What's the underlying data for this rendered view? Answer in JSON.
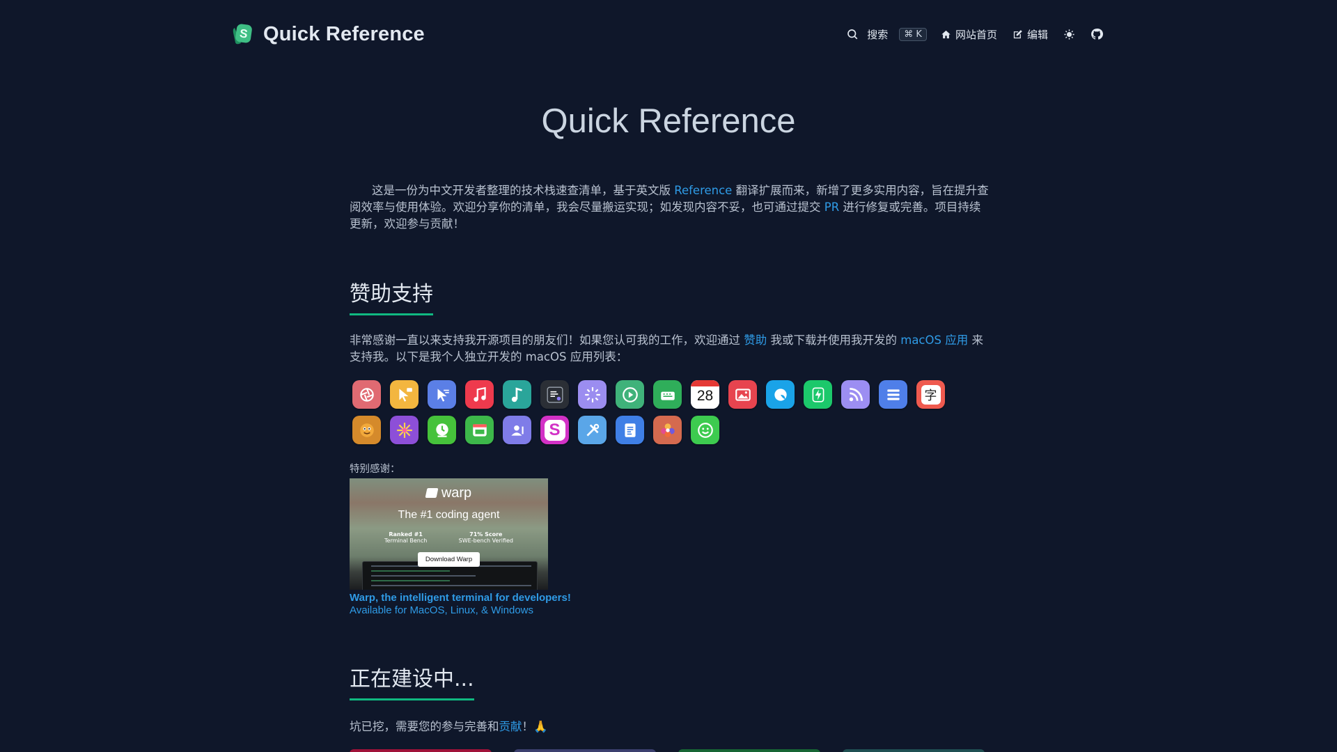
{
  "header": {
    "brand_title": "Quick Reference",
    "search_label": "搜索",
    "search_shortcut": "⌘ K",
    "home_label": "网站首页",
    "edit_label": "编辑"
  },
  "hero": {
    "title": "Quick Reference",
    "intro_1": "这是一份为中文开发者整理的技术栈速查清单，基于英文版 ",
    "intro_link_reference": "Reference",
    "intro_2": " 翻译扩展而来，新增了更多实用内容，旨在提升查阅效率与使用体验。欢迎分享你的清单，我会尽量搬运实现；如发现内容不妥，也可通过提交 ",
    "intro_link_pr": "PR",
    "intro_3": " 进行修复或完善。项目持续更新，欢迎参与贡献！"
  },
  "sponsor": {
    "heading": "赞助支持",
    "text_1": "非常感谢一直以来支持我开源项目的朋友们！如果您认可我的工作，欢迎通过 ",
    "link_sponsor": "赞助",
    "text_2": " 我或下载并使用我开发的 ",
    "link_macos": "macOS 应用",
    "text_3": " 来支持我。以下是我个人独立开发的 macOS 应用列表：",
    "apps": [
      {
        "icon": "aperture-icon",
        "bg": "#e06a72"
      },
      {
        "icon": "cursor-note-icon",
        "bg": "#f3b63f"
      },
      {
        "icon": "pointer-icon",
        "bg": "#5b7fe6"
      },
      {
        "icon": "music-note-icon",
        "bg": "#ee3a4d"
      },
      {
        "icon": "music-teal-icon",
        "bg": "#2aa59a"
      },
      {
        "icon": "terminal-icon",
        "bg": "#2b2f36"
      },
      {
        "icon": "sparkle-cursor-icon",
        "bg": "#9b8df0"
      },
      {
        "icon": "play-icon",
        "bg": "#3fb27a"
      },
      {
        "icon": "keyboard-icon",
        "bg": "#2fae5a"
      },
      {
        "icon": "calendar-icon",
        "bg": "#f4f4f4"
      },
      {
        "icon": "photo-icon",
        "bg": "#e7444f"
      },
      {
        "icon": "bubble-icon",
        "bg": "#1aa3e8"
      },
      {
        "icon": "bolt-icon",
        "bg": "#1cc86b"
      },
      {
        "icon": "rss-icon",
        "bg": "#9c8ef2"
      },
      {
        "icon": "list-icon",
        "bg": "#4f7fe9"
      },
      {
        "icon": "character-icon",
        "bg": "#ef5a4f"
      },
      {
        "icon": "mascot-icon",
        "bg": "#d58a2b"
      },
      {
        "icon": "color-burst-icon",
        "bg": "#8d4fd8"
      },
      {
        "icon": "clock-icon",
        "bg": "#46c23b"
      },
      {
        "icon": "window-icon",
        "bg": "#3db84a"
      },
      {
        "icon": "contacts-icon",
        "bg": "#7f7ce8"
      },
      {
        "icon": "letter-s-icon",
        "bg": "#d231c6"
      },
      {
        "icon": "tools-icon",
        "bg": "#5aa6e8"
      },
      {
        "icon": "document-icon",
        "bg": "#3f7fe6"
      },
      {
        "icon": "flower-icon",
        "bg": "#d56a4f"
      },
      {
        "icon": "smile-icon",
        "bg": "#3dcb4f"
      }
    ],
    "calendar_day": "28",
    "letter_s": "S",
    "character_glyph": "字",
    "special_thanks": "特别感谢：",
    "ad": {
      "brand": "warp",
      "tagline": "The #1 coding agent",
      "rank_title": "Ranked #1",
      "rank_sub": "Terminal Bench",
      "score_title": "71% Score",
      "score_sub": "SWE-bench Verified",
      "button": "Download Warp"
    },
    "caption_title": "Warp, the intelligent terminal for developers!",
    "caption_sub": "Available for MacOS, Linux, & Windows"
  },
  "wip": {
    "heading": "正在建设中...",
    "text_1": "坑已挖，需要您的参与完善和",
    "link_contribute": "贡献",
    "text_2": "！🙏",
    "card_colors": [
      "#9f1239",
      "#3b3f6e",
      "#166534",
      "#1f4f52"
    ]
  },
  "colors": {
    "background": "#0f172a",
    "link": "#2f9be6",
    "accent": "#10b981"
  }
}
